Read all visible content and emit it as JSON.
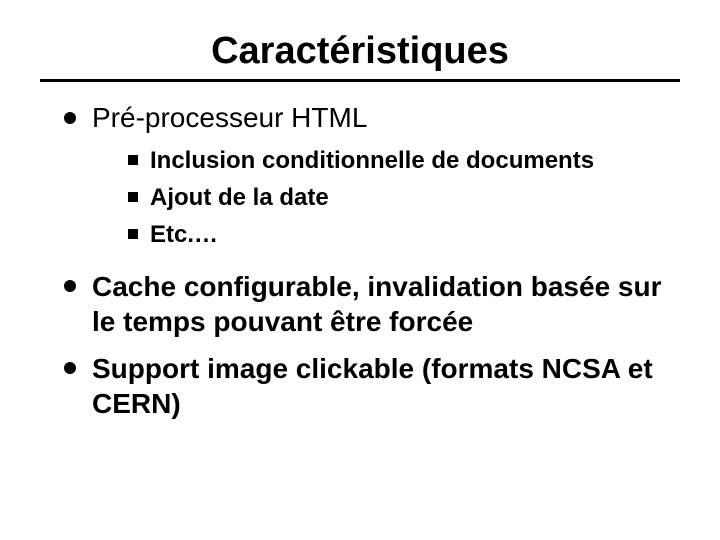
{
  "title": "Caractéristiques",
  "bullets": {
    "b1": {
      "label": "Pré-processeur HTML",
      "sub": {
        "s1": "Inclusion conditionnelle de documents",
        "s2": "Ajout de la date",
        "s3": "Etc.…"
      }
    },
    "b2": {
      "label": "Cache configurable, invalidation basée sur le temps pouvant être forcée"
    },
    "b3": {
      "label": "Support image clickable (formats NCSA et CERN)"
    }
  }
}
